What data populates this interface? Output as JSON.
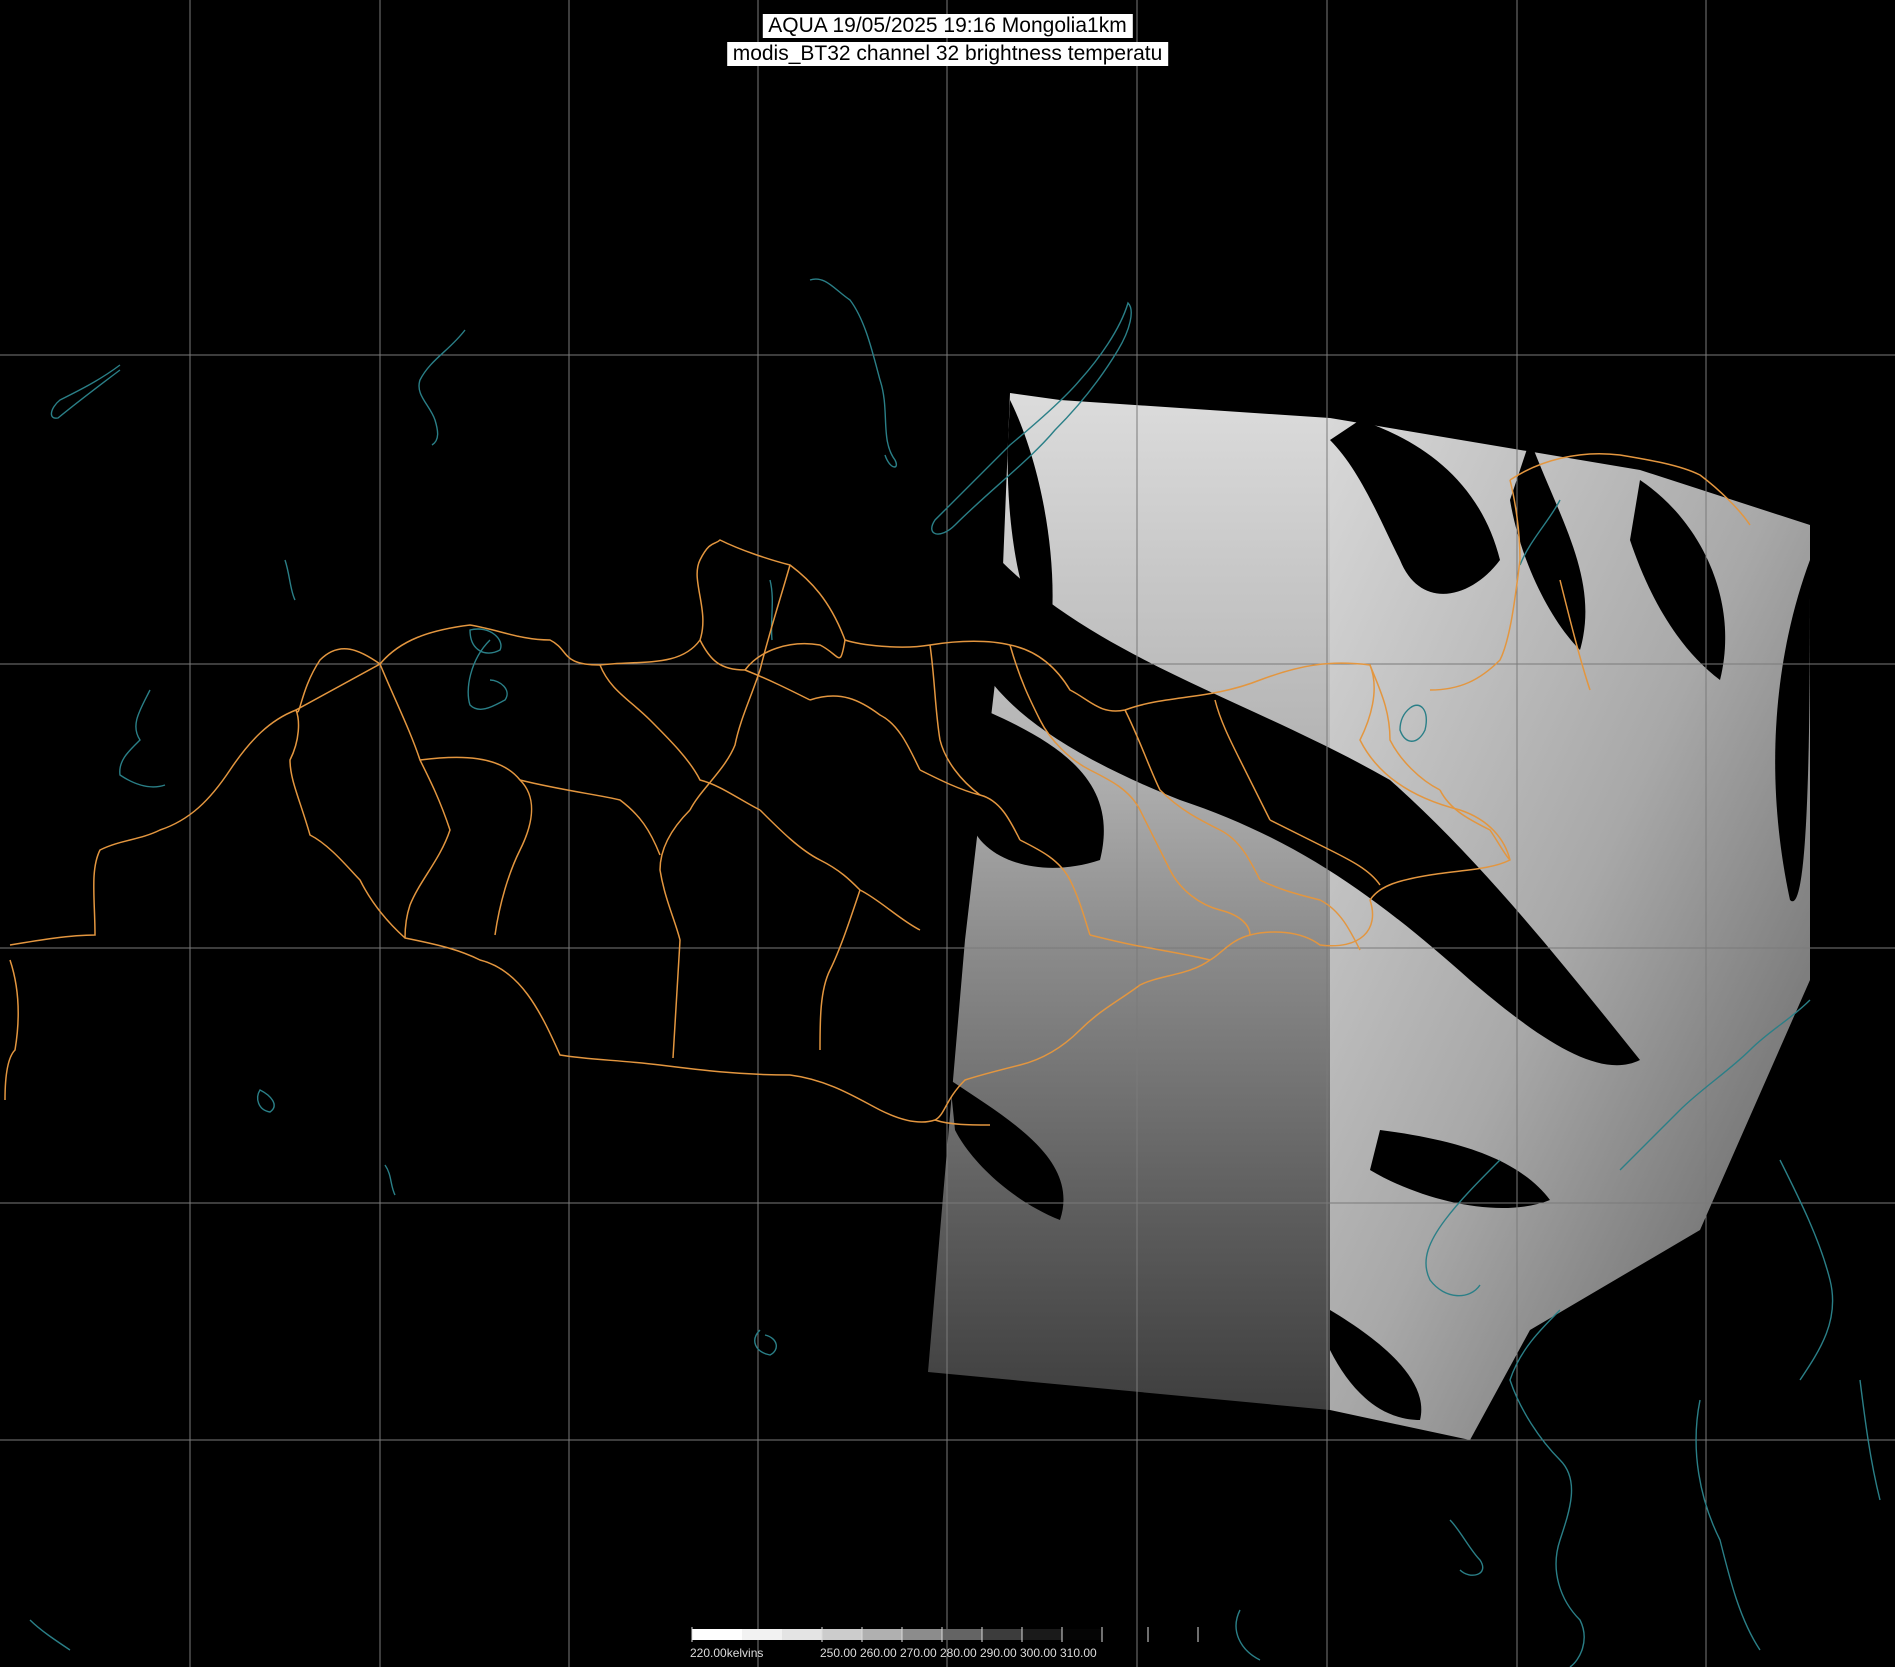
{
  "header": {
    "line1": "AQUA 19/05/2025 19:16 Mongolia1km",
    "line2": "modis_BT32 channel 32 brightness temperatu"
  },
  "colors": {
    "background": "#000000",
    "grid": "#7a7a7a",
    "boundary": "#e3963f",
    "coast": "#2a7f87",
    "title_bg": "#ffffff"
  },
  "scale": {
    "labels": [
      "220.00kelvins",
      "250.00",
      "260.00",
      "270.00",
      "280.00",
      "290.00",
      "300.00",
      "310.00"
    ]
  }
}
